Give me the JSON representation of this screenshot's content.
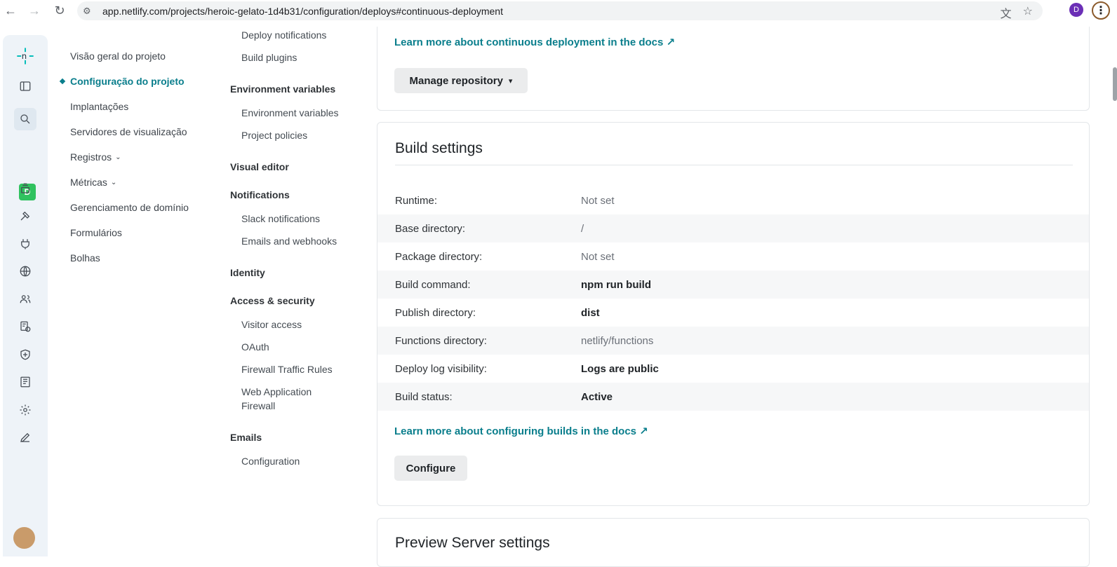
{
  "browser": {
    "url": "app.netlify.com/projects/heroic-gelato-1d4b31/configuration/deploys#continuous-deployment",
    "profile_initial": "D"
  },
  "rail": {
    "team_initial": "D"
  },
  "primary_nav": {
    "items": [
      {
        "label": "Visão geral do projeto"
      },
      {
        "label": "Configuração do projeto"
      },
      {
        "label": "Implantações"
      },
      {
        "label": "Servidores de visualização"
      },
      {
        "label": "Registros"
      },
      {
        "label": "Métricas"
      },
      {
        "label": "Gerenciamento de domínio"
      },
      {
        "label": "Formulários"
      },
      {
        "label": "Bolhas"
      }
    ]
  },
  "secondary_nav": {
    "deploy_notifications": "Deploy notifications",
    "build_plugins": "Build plugins",
    "env_head": "Environment variables",
    "env_vars": "Environment variables",
    "project_policies": "Project policies",
    "visual_editor": "Visual editor",
    "notifications": "Notifications",
    "slack": "Slack notifications",
    "emails_webhooks": "Emails and webhooks",
    "identity": "Identity",
    "access_security": "Access & security",
    "visitor_access": "Visitor access",
    "oauth": "OAuth",
    "firewall": "Firewall Traffic Rules",
    "waf_1": "Web Application",
    "waf_2": "Firewall",
    "emails": "Emails",
    "configuration": "Configuration"
  },
  "continuous_deployment": {
    "docs_link": "Learn more about continuous deployment in the docs ↗",
    "manage_button": "Manage repository"
  },
  "build_settings": {
    "title": "Build settings",
    "rows": [
      {
        "label": "Runtime:",
        "value": "Not set"
      },
      {
        "label": "Base directory:",
        "value": "/"
      },
      {
        "label": "Package directory:",
        "value": "Not set"
      },
      {
        "label": "Build command:",
        "value": "npm run build"
      },
      {
        "label": "Publish directory:",
        "value": "dist"
      },
      {
        "label": "Functions directory:",
        "value": "netlify/functions"
      },
      {
        "label": "Deploy log visibility:",
        "value": "Logs are public"
      },
      {
        "label": "Build status:",
        "value": "Active"
      }
    ],
    "docs_link": "Learn more about configuring builds in the docs ↗",
    "configure_button": "Configure"
  },
  "preview_server": {
    "title": "Preview Server settings"
  }
}
